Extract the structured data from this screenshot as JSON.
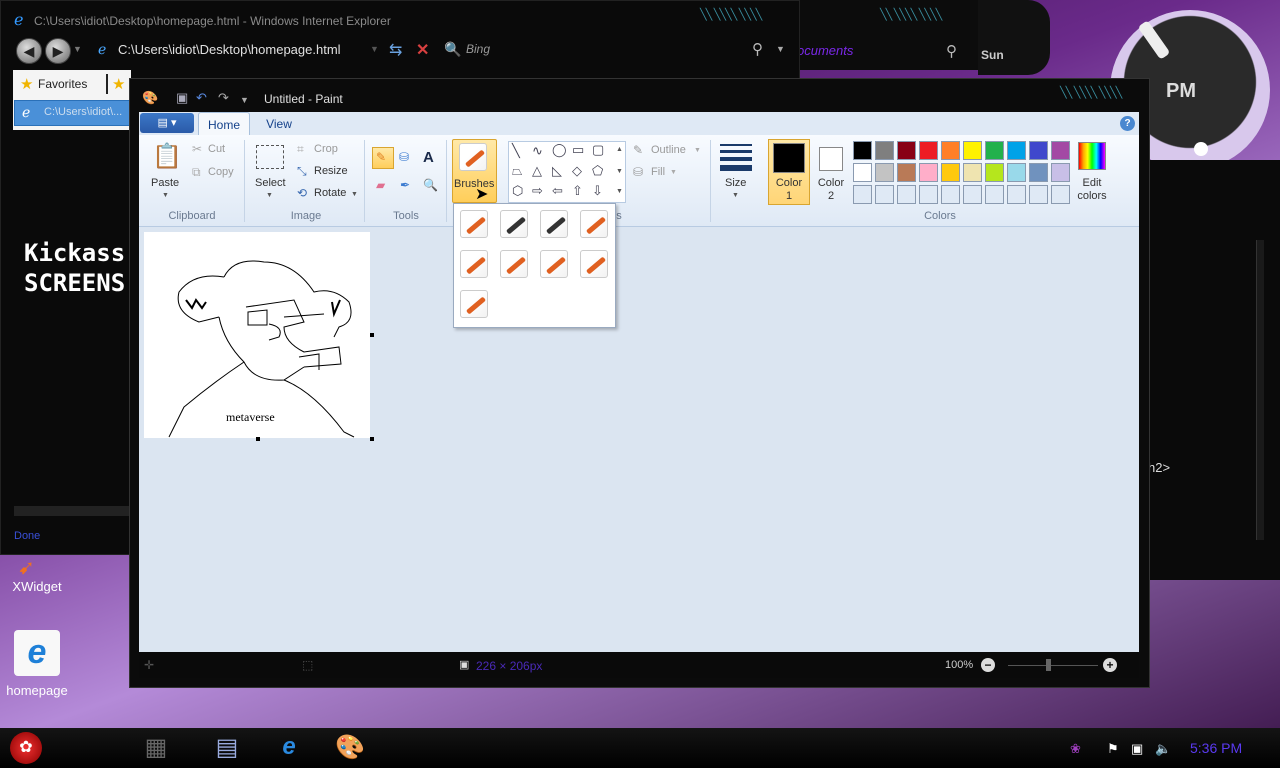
{
  "ie": {
    "title": "C:\\Users\\idiot\\Desktop\\homepage.html - Windows Internet Explorer",
    "address": "C:\\Users\\idiot\\Desktop\\homepage.html",
    "search_placeholder": "Bing",
    "favorites_label": "Favorites",
    "tab_label": "C:\\Users\\idiot\\...",
    "page_text_line1": "Kickass",
    "page_text_line2": "SCREENS",
    "status": "Done"
  },
  "background": {
    "documents_link": "ocuments",
    "day_label": "Sun",
    "clock_label": "PM",
    "right_window_text": "h2>"
  },
  "desktop_icons": [
    {
      "label": "XWidget"
    },
    {
      "label": "homepage"
    }
  ],
  "paint": {
    "title": "Untitled - Paint",
    "tabs": [
      "Home",
      "View"
    ],
    "groups": {
      "clipboard": "Clipboard",
      "image": "Image",
      "tools": "Tools",
      "shapes": "es",
      "colors": "Colors"
    },
    "buttons": {
      "paste": "Paste",
      "cut": "Cut",
      "copy": "Copy",
      "select": "Select",
      "crop": "Crop",
      "resize": "Resize",
      "rotate": "Rotate",
      "brushes": "Brushes",
      "outline": "Outline",
      "fill": "Fill",
      "size": "Size",
      "color1_line1": "Color",
      "color1_line2": "1",
      "color2_line1": "Color",
      "color2_line2": "2",
      "edit_colors_line1": "Edit",
      "edit_colors_line2": "colors"
    },
    "palette_row1": [
      "#000000",
      "#7f7f7f",
      "#880015",
      "#ed1c24",
      "#ff7f27",
      "#fff200",
      "#22b14c",
      "#00a2e8",
      "#3f48cc",
      "#a349a4"
    ],
    "palette_row2": [
      "#ffffff",
      "#c3c3c3",
      "#b97a57",
      "#ffaec9",
      "#ffc90e",
      "#efe4b0",
      "#b5e61d",
      "#99d9ea",
      "#7092be",
      "#c8bfe7"
    ],
    "canvas_text": "metaverse",
    "status_size": "226 × 206px",
    "zoom": "100%"
  },
  "taskbar": {
    "time": "5:36 PM"
  }
}
